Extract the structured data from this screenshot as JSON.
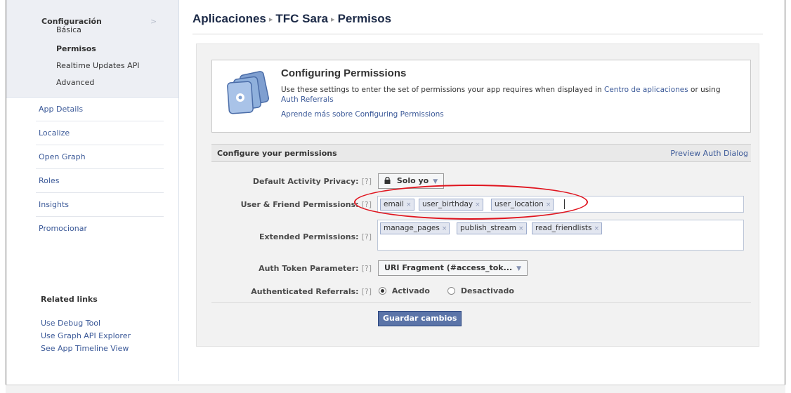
{
  "sidebar": {
    "section_title": "Configuración",
    "chevron": ">",
    "sub_items": [
      {
        "label": "Básica",
        "active": false
      },
      {
        "label": "Permisos",
        "active": true
      },
      {
        "label": "Realtime Updates API",
        "active": false
      },
      {
        "label": "Advanced",
        "active": false
      }
    ],
    "nav_items": [
      "App Details",
      "Localize",
      "Open Graph",
      "Roles",
      "Insights",
      "Promocionar"
    ],
    "related_title": "Related links",
    "related_links": [
      "Use Debug Tool",
      "Use Graph API Explorer",
      "See App Timeline View"
    ]
  },
  "breadcrumb": {
    "items": [
      "Aplicaciones",
      "TFC Sara",
      "Permisos"
    ],
    "separator": "▸"
  },
  "intro": {
    "title": "Configuring Permissions",
    "text_before": "Use these settings to enter the set of permissions your app requires when displayed in ",
    "link_center": "Centro de aplicaciones",
    "text_middle": " or using ",
    "link_referrals": "Auth Referrals",
    "learn_more": "Aprende más sobre Configuring Permissions",
    "icon": "app-settings-icon"
  },
  "permissions": {
    "section_title": "Configure your permissions",
    "preview_link": "Preview Auth Dialog",
    "help": "[?]",
    "default_privacy_label": "Default Activity Privacy:",
    "default_privacy_value": "Solo yo",
    "user_friend_label": "User & Friend Permissions:",
    "user_friend_tokens": [
      "email",
      "user_birthday",
      "user_location"
    ],
    "extended_label": "Extended Permissions:",
    "extended_tokens": [
      "manage_pages",
      "publish_stream",
      "read_friendlists"
    ],
    "auth_token_label": "Auth Token Parameter:",
    "auth_token_value": "URI Fragment (#access_tok...",
    "auth_referrals_label": "Authenticated Referrals:",
    "auth_referrals_options": [
      "Activado",
      "Desactivado"
    ],
    "auth_referrals_selected": "Activado",
    "token_remove_glyph": "×",
    "save_button": "Guardar cambios"
  },
  "colors": {
    "link": "#3b5998",
    "button_bg": "#5b74a8",
    "highlight_ellipse": "#e0141e"
  }
}
